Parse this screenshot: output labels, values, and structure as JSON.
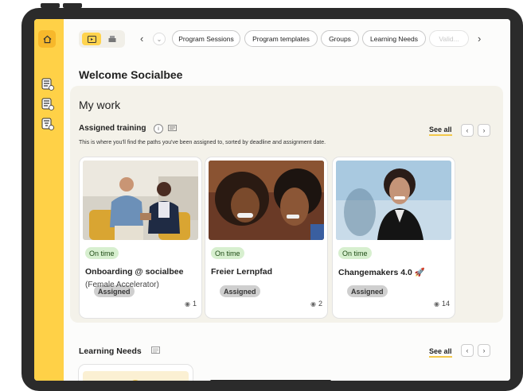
{
  "rail": {
    "items": [
      {
        "icon": "home-icon"
      },
      {
        "icon": "list-icon"
      },
      {
        "icon": "list-icon"
      },
      {
        "icon": "filter-list-icon"
      }
    ]
  },
  "topbar": {
    "tabs": [
      "Program Sessions",
      "Program templates",
      "Groups",
      "Learning Needs",
      "Valid..."
    ]
  },
  "welcome": "Welcome Socialbee",
  "my_work": {
    "heading": "My work",
    "assigned_title": "Assigned training",
    "info_symbol": "i",
    "description": "This is where you'll find the paths you've been assigned to, sorted by deadline and assignment date.",
    "see_all": "See all",
    "cards": [
      {
        "status": "On time",
        "state": "Assigned",
        "title": "Onboarding @ socialbee",
        "subtitle": "(Female Accelerator)",
        "count": "1"
      },
      {
        "status": "On time",
        "state": "Assigned",
        "title": "Freier Lernpfad",
        "subtitle": "",
        "count": "2"
      },
      {
        "status": "On time",
        "state": "Assigned",
        "title": "Changemakers 4.0 🚀",
        "subtitle": "",
        "count": "14"
      }
    ]
  },
  "learning_needs": {
    "heading": "Learning Needs",
    "see_all": "See all"
  }
}
